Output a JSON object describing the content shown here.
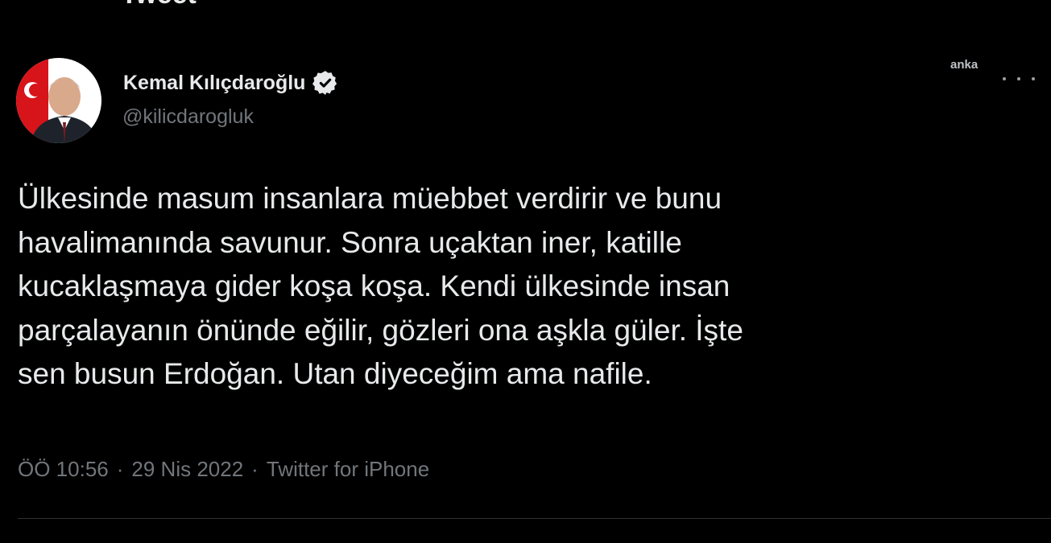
{
  "header": {
    "title": "Tweet"
  },
  "author": {
    "display_name": "Kemal Kılıçdaroğlu",
    "handle": "@kilicdarogluk",
    "verified_icon": "verified-badge-icon"
  },
  "watermark": "anka",
  "tweet": {
    "text": "Ülkesinde masum insanlara müebbet verdirir ve bunu\nhavalimanında savunur. Sonra uçaktan iner, katille\nkucaklaşmaya gider koşa koşa. Kendi ülkesinde insan\nparçalayanın önünde eğilir, gözleri ona aşkla güler. İşte\nsen busun Erdoğan. Utan diyeceğim ama nafile.",
    "time": "ÖÖ 10:56",
    "date": "29 Nis 2022",
    "source": "Twitter for iPhone",
    "separator": "·"
  },
  "colors": {
    "background": "#000000",
    "primary_text": "#e7e9ea",
    "secondary_text": "#71767b",
    "verified": "#e7e9ea"
  }
}
